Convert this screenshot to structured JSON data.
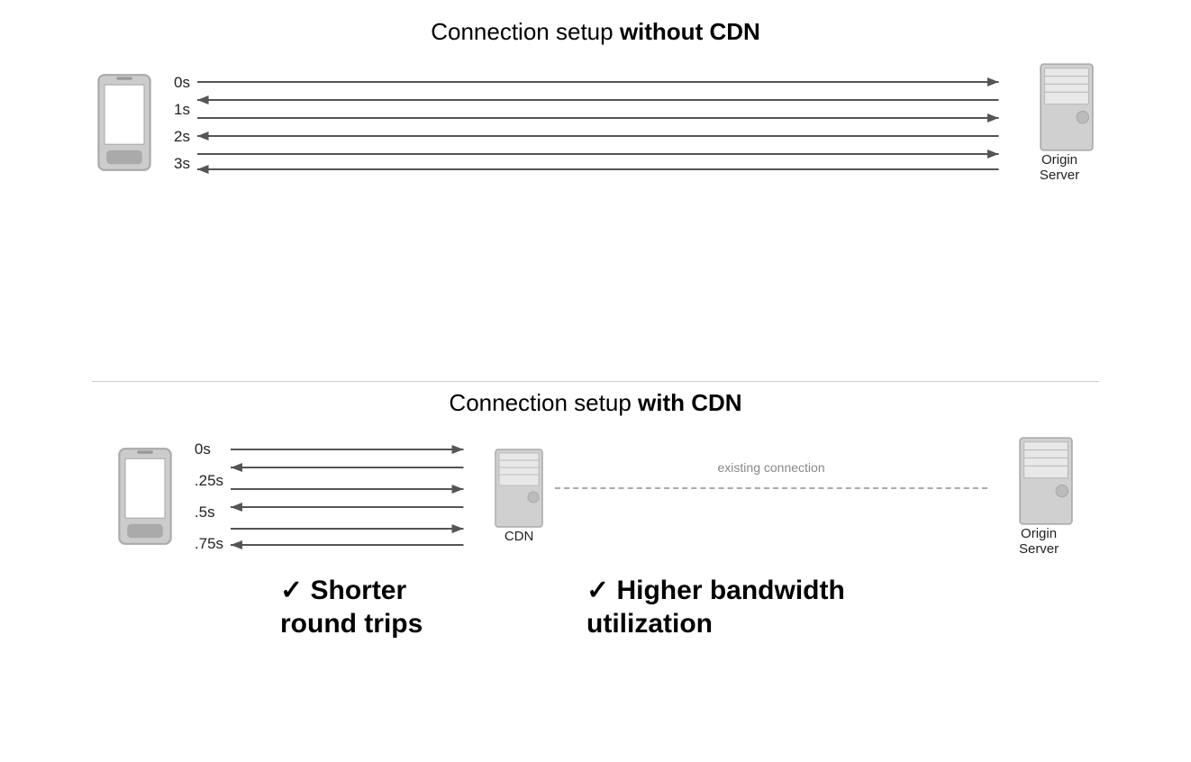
{
  "top": {
    "title_normal": "Connection setup ",
    "title_bold": "without CDN",
    "time_labels": [
      "0s",
      "1s",
      "2s",
      "3s"
    ],
    "server_label": "Origin\nServer"
  },
  "bottom": {
    "title_normal": "Connection setup ",
    "title_bold": "with CDN",
    "time_labels": [
      "0s",
      ".25s",
      ".5s",
      ".75s"
    ],
    "cdn_label": "CDN",
    "existing_label": "existing connection",
    "server_label": "Origin\nServer",
    "benefit1_check": "✓",
    "benefit1_text": "Shorter\nround trips",
    "benefit2_check": "✓",
    "benefit2_text": "Higher bandwidth\nutilization"
  }
}
